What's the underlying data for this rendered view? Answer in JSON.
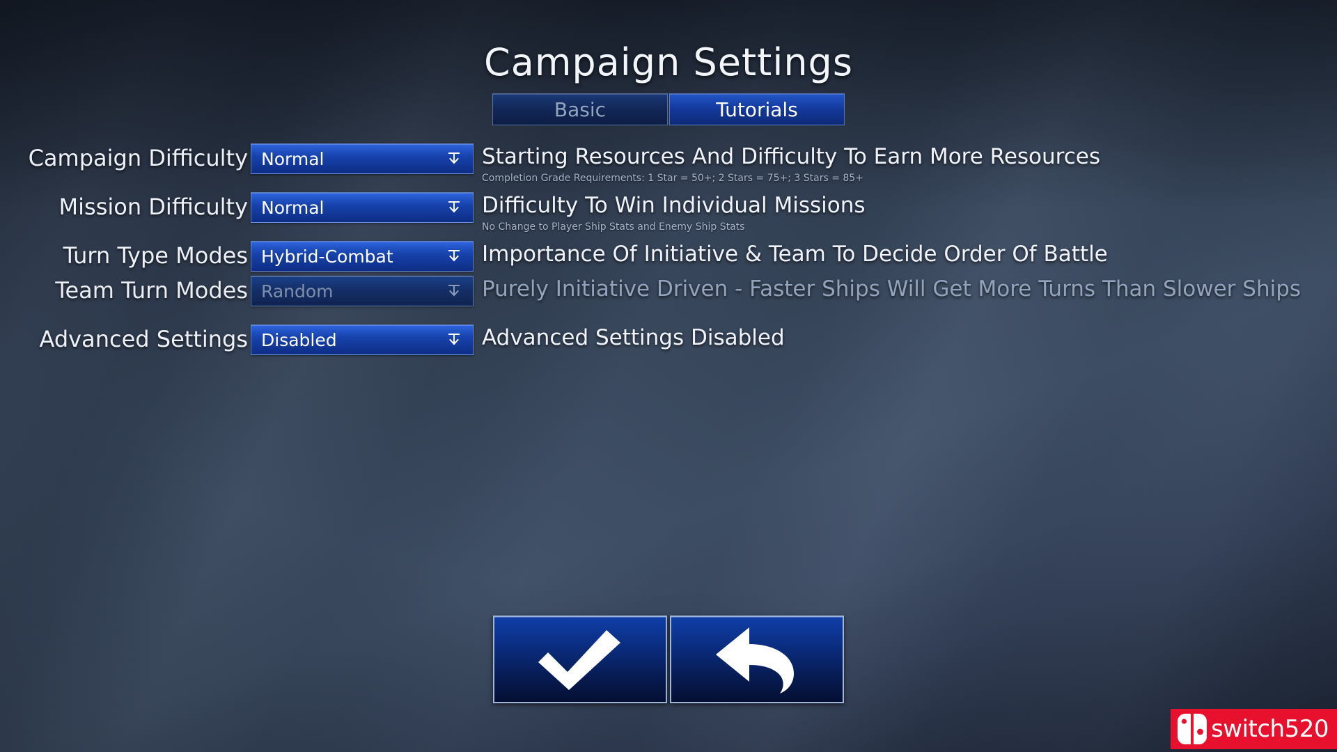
{
  "window": {
    "title": "Campaign Settings"
  },
  "tabs": [
    {
      "label": "Basic",
      "active": false
    },
    {
      "label": "Tutorials",
      "active": true
    }
  ],
  "settings": [
    {
      "label": "Campaign Difficulty",
      "value": "Normal",
      "enabled": true,
      "description": "Starting Resources And Difficulty To Earn More Resources",
      "sub_description": "Completion Grade Requirements: 1 Star = 50+; 2 Stars = 75+; 3 Stars = 85+",
      "arrow_icon": "dropdown-arrow-icon"
    },
    {
      "label": "Mission Difficulty",
      "value": "Normal",
      "enabled": true,
      "description": "Difficulty To Win Individual Missions",
      "sub_description": "No Change to Player Ship Stats and Enemy Ship Stats",
      "arrow_icon": "dropdown-arrow-icon"
    },
    {
      "label": "Turn Type Modes",
      "value": "Hybrid-Combat",
      "enabled": true,
      "description": "Importance Of Initiative & Team To Decide Order Of Battle",
      "sub_description": "",
      "arrow_icon": "dropdown-arrow-icon"
    },
    {
      "label": "Team Turn Modes",
      "value": "Random",
      "enabled": false,
      "description": "Purely Initiative Driven - Faster Ships Will Get More Turns Than Slower Ships",
      "sub_description": "",
      "arrow_icon": "dropdown-arrow-icon"
    },
    {
      "label": "Advanced Settings",
      "value": "Disabled",
      "enabled": true,
      "description": "Advanced Settings Disabled",
      "sub_description": "",
      "arrow_icon": "dropdown-arrow-icon"
    }
  ],
  "actions": [
    {
      "name": "confirm",
      "icon": "checkmark-icon"
    },
    {
      "name": "back",
      "icon": "undo-arrow-icon"
    }
  ],
  "watermark": {
    "text": "switch520",
    "icon": "nintendo-switch-icon",
    "background_color": "#e8112d",
    "text_color": "#ffffff"
  },
  "colors": {
    "accent_active": "#2356c8",
    "accent_inactive": "#12285a",
    "text_primary": "#f0f4fa",
    "text_dim": "#93a3bb",
    "text_sub": "#a6b5cb",
    "background": "#2a3547"
  }
}
